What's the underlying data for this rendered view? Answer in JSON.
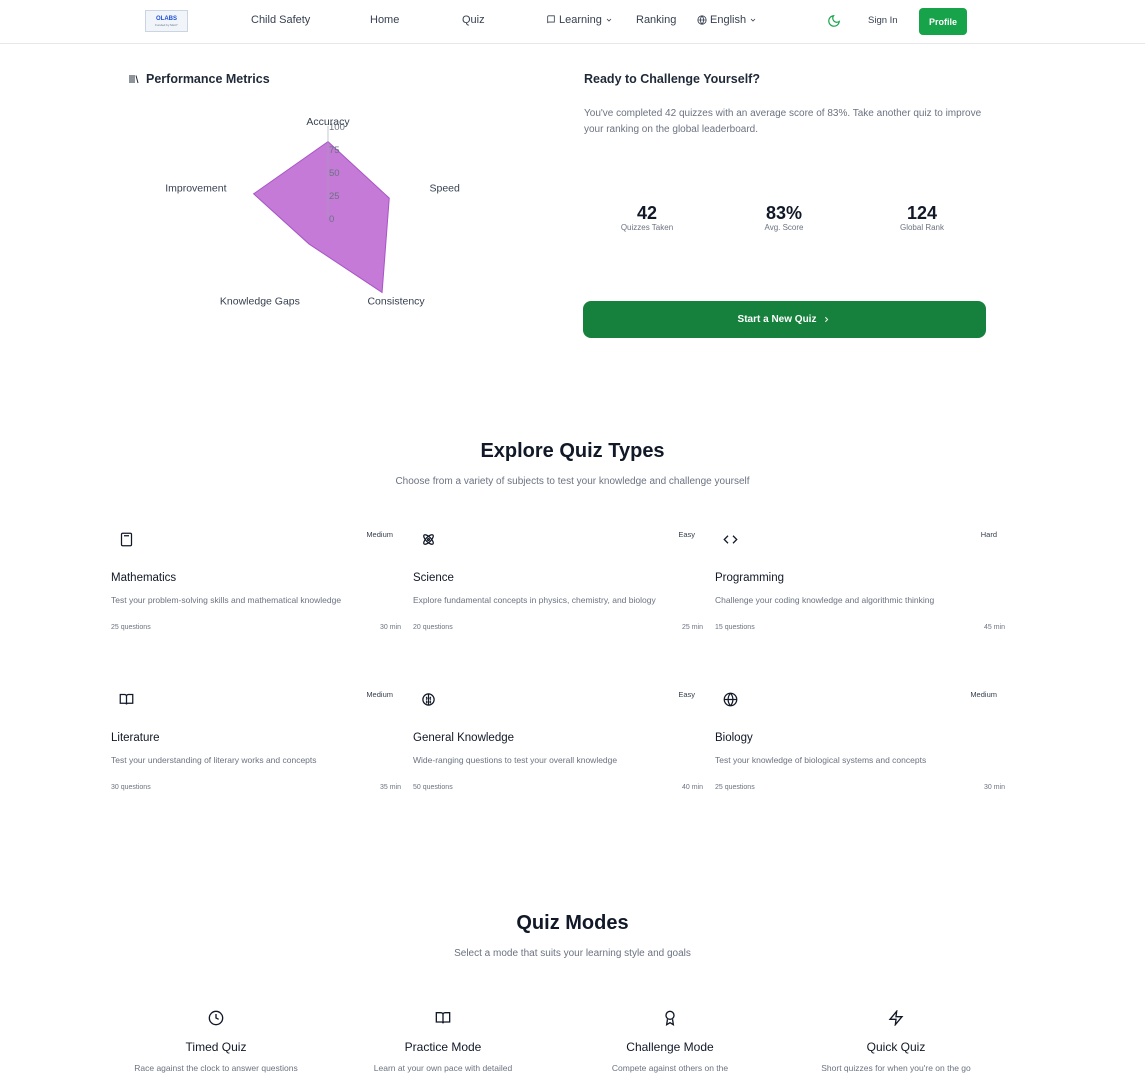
{
  "nav": {
    "logo_text": "OLABS",
    "logo_sub": "Funded by MeitY",
    "links": [
      "Child Safety",
      "Home",
      "Quiz",
      "Learning",
      "Ranking",
      "English"
    ],
    "sign_in": "Sign In",
    "profile": "Profile",
    "accent_color": "#16a34a"
  },
  "metrics": {
    "title": "Performance Metrics",
    "icon": "library-icon"
  },
  "chart_data": {
    "type": "radar",
    "axes": [
      "Accuracy",
      "Speed",
      "Consistency",
      "Knowledge Gaps",
      "Improvement"
    ],
    "values": [
      83,
      70,
      100,
      35,
      85
    ],
    "radial_ticks": [
      "100",
      "75",
      "50",
      "25",
      "0"
    ],
    "range": [
      0,
      100
    ],
    "fill_color": "#c47ad6",
    "stroke_color": "#a855c7"
  },
  "challenge": {
    "title": "Ready to Challenge Yourself?",
    "description": "You've completed 42 quizzes with an average score of 83%. Take another quiz to improve your ranking on the global leaderboard.",
    "stats": [
      {
        "value": "42",
        "label": "Quizzes Taken"
      },
      {
        "value": "83%",
        "label": "Avg. Score"
      },
      {
        "value": "124",
        "label": "Global Rank"
      }
    ],
    "button": "Start a New Quiz"
  },
  "explore": {
    "title": "Explore Quiz Types",
    "subtitle": "Choose from a variety of subjects to test your knowledge and challenge yourself",
    "cards": [
      {
        "name": "Mathematics",
        "difficulty": "Medium",
        "description": "Test your problem-solving skills and mathematical knowledge",
        "questions": "25 questions",
        "time": "30 min",
        "icon": "calculator-icon"
      },
      {
        "name": "Science",
        "difficulty": "Easy",
        "description": "Explore fundamental concepts in physics, chemistry, and biology",
        "questions": "20 questions",
        "time": "25 min",
        "icon": "atom-icon"
      },
      {
        "name": "Programming",
        "difficulty": "Hard",
        "description": "Challenge your coding knowledge and algorithmic thinking",
        "questions": "15 questions",
        "time": "45 min",
        "icon": "code-icon"
      },
      {
        "name": "Literature",
        "difficulty": "Medium",
        "description": "Test your understanding of literary works and concepts",
        "questions": "30 questions",
        "time": "35 min",
        "icon": "book-icon"
      },
      {
        "name": "General Knowledge",
        "difficulty": "Easy",
        "description": "Wide-ranging questions to test your overall knowledge",
        "questions": "50 questions",
        "time": "40 min",
        "icon": "brain-icon"
      },
      {
        "name": "Biology",
        "difficulty": "Medium",
        "description": "Test your knowledge of biological systems and concepts",
        "questions": "25 questions",
        "time": "30 min",
        "icon": "globe-icon"
      }
    ]
  },
  "modes": {
    "title": "Quiz Modes",
    "subtitle": "Select a mode that suits your learning style and goals",
    "items": [
      {
        "name": "Timed Quiz",
        "description": "Race against the clock to answer questions",
        "icon": "clock-icon"
      },
      {
        "name": "Practice Mode",
        "description": "Learn at your own pace with detailed",
        "icon": "book-open-icon"
      },
      {
        "name": "Challenge Mode",
        "description": "Compete against others on the",
        "icon": "award-icon"
      },
      {
        "name": "Quick Quiz",
        "description": "Short quizzes for when you're on the go",
        "icon": "zap-icon"
      }
    ]
  }
}
